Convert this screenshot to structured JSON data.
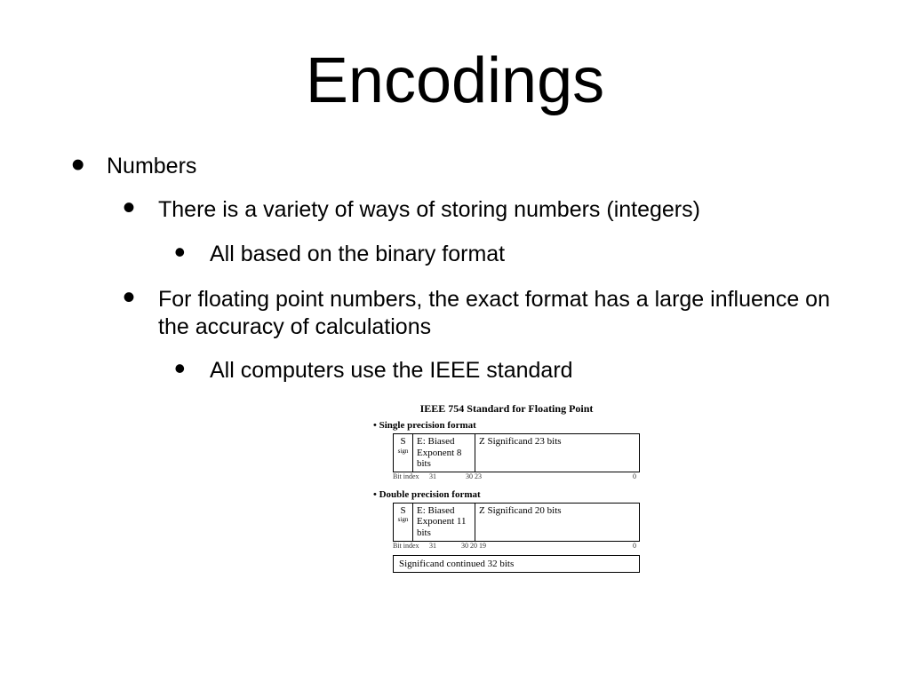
{
  "title": "Encodings",
  "b1": "Numbers",
  "b1_1": "There is a variety of ways of storing numbers (integers)",
  "b1_1_1": "All based on the binary format",
  "b1_2": "For floating point numbers, the exact format has a large influence on the accuracy of calculations",
  "b1_2_1": "All computers use the IEEE standard",
  "diagram": {
    "title": "IEEE 754 Standard for Floating Point",
    "bit_label": "Bit index",
    "single": {
      "label": "Single precision format",
      "s": "S",
      "s_sub": "sign",
      "e": "E: Biased Exponent 8 bits",
      "z": "Z Significand 23 bits",
      "idx": [
        "31",
        "30        23",
        "0"
      ]
    },
    "double": {
      "label": "Double precision format",
      "s": "S",
      "s_sub": "sign",
      "e": "E: Biased Exponent 11 bits",
      "z": "Z Significand 20 bits",
      "idx": [
        "31",
        "30    20 19",
        "0"
      ],
      "cont": "Significand continued 32 bits"
    }
  }
}
